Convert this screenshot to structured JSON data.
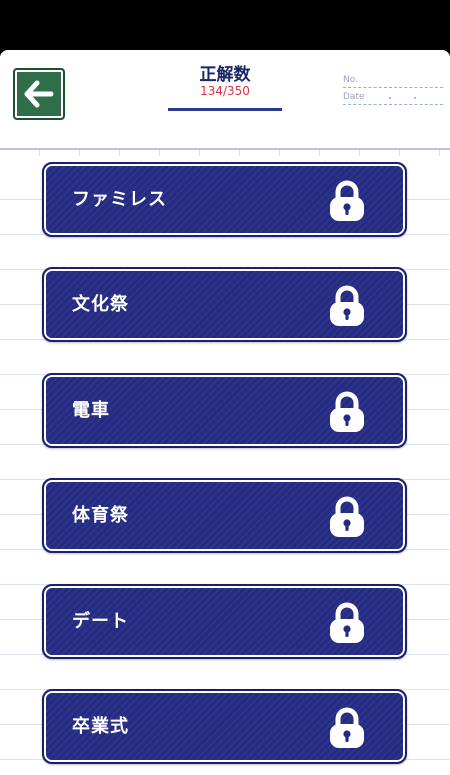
{
  "header": {
    "title": "正解数",
    "score": "134/350",
    "no_label": "No.",
    "date_label": "Date"
  },
  "colors": {
    "button_fill": "#252b82",
    "back_button": "#2e6f4a",
    "score_text": "#d8324c"
  },
  "categories": [
    {
      "label": "ファミレス",
      "icon": "lock-icon"
    },
    {
      "label": "文化祭",
      "icon": "lock-icon"
    },
    {
      "label": "電車",
      "icon": "lock-icon"
    },
    {
      "label": "体育祭",
      "icon": "lock-icon"
    },
    {
      "label": "デート",
      "icon": "lock-icon"
    },
    {
      "label": "卒業式",
      "icon": "lock-icon"
    }
  ]
}
